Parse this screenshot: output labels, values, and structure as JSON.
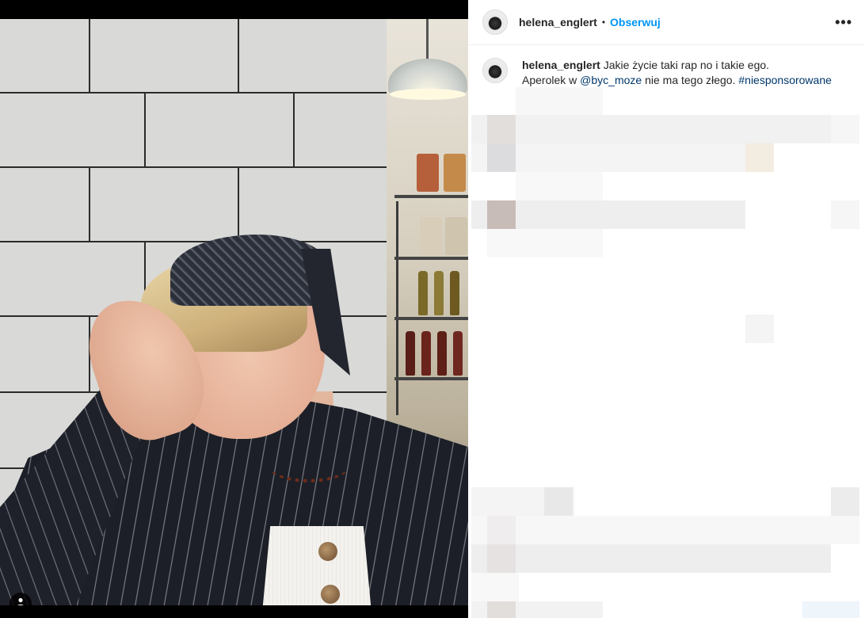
{
  "post": {
    "username": "helena_englert",
    "separator": "•",
    "follow_label": "Obserwuj",
    "more_label": "•••",
    "caption": {
      "text_1": "Jakie życie taki rap no i takie ego.",
      "text_2": "Aperolek w",
      "mention": "@byc_moze",
      "text_3": "nie ma tego złego.",
      "hashtag": "#niesponsorowane"
    }
  },
  "icons": {
    "user_tag": "person-icon",
    "more": "ellipsis-icon"
  },
  "colors": {
    "follow": "#0095f6",
    "link": "#00376b",
    "text": "#262626"
  }
}
